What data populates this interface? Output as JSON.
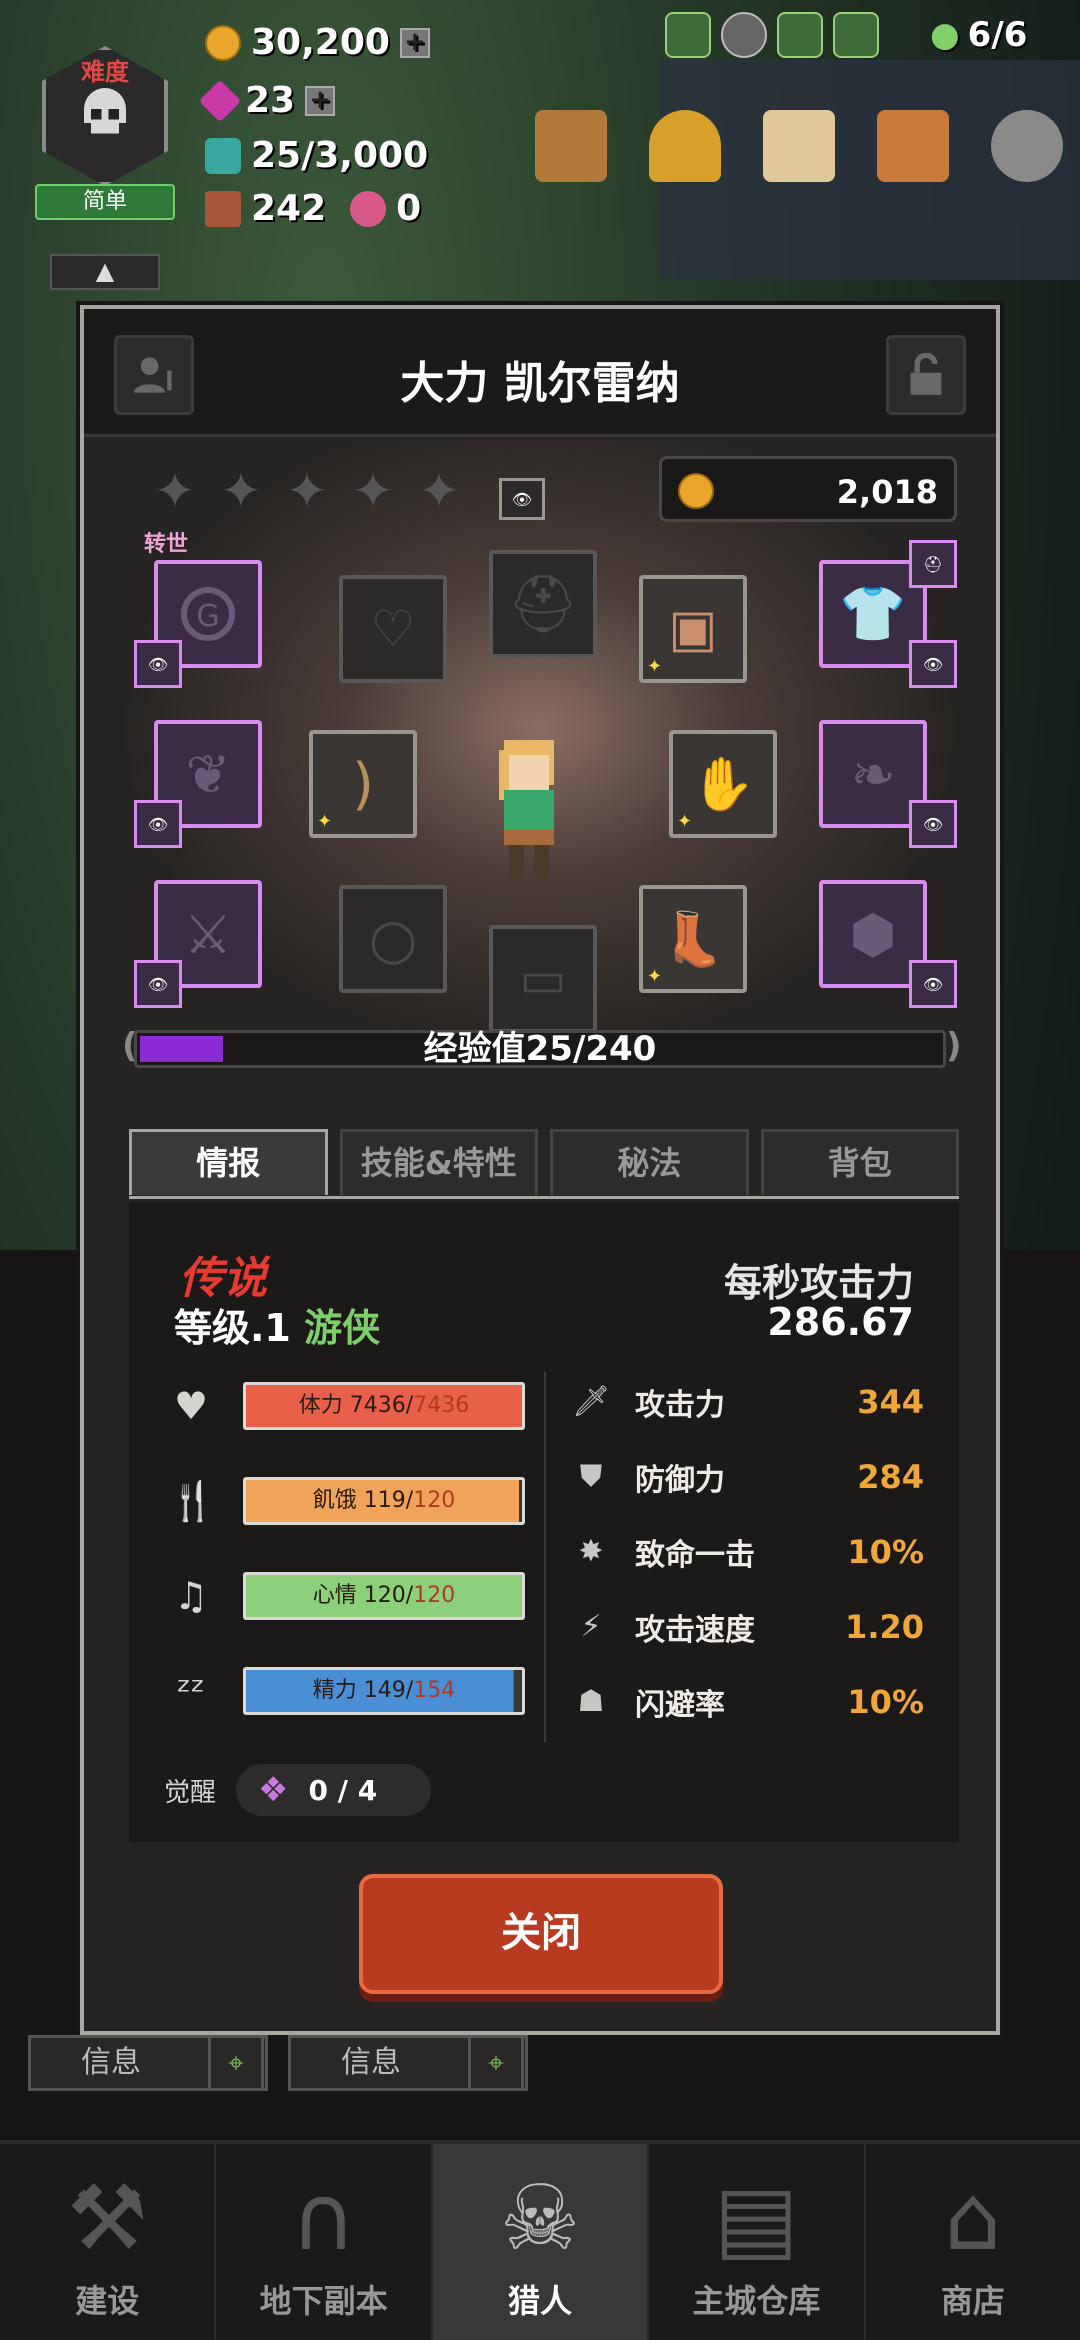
{
  "difficulty": {
    "label": "难度",
    "value": "简单"
  },
  "resources": {
    "gold": "30,200",
    "gems": "23",
    "mana": "25/3,000",
    "chests": "242",
    "crystals": "0"
  },
  "hunter_slots": "6/6",
  "modal": {
    "title": "大力 凯尔雷纳",
    "rebirth_label": "转世",
    "gold_amount": "2,018",
    "xp_text": "经验值25/240",
    "xp_progress": 0.104,
    "tabs": [
      {
        "label": "情报",
        "active": true
      },
      {
        "label": "技能&特性",
        "active": false
      },
      {
        "label": "秘法",
        "active": false
      },
      {
        "label": "背包",
        "active": false
      }
    ],
    "info": {
      "rarity": "传说",
      "level_prefix": "等级.1",
      "class_name": "游侠",
      "dps_label": "每秒攻击力",
      "dps_value": "286.67",
      "needs": [
        {
          "label": "体力",
          "current": "7436",
          "max": "7436",
          "color": "#e8604a",
          "fill": 1.0
        },
        {
          "label": "飢饿",
          "current": "119",
          "max": "120",
          "color": "#f0a45a",
          "fill": 0.99
        },
        {
          "label": "心情",
          "current": "120",
          "max": "120",
          "color": "#8cd07a",
          "fill": 1.0
        },
        {
          "label": "精力",
          "current": "149",
          "max": "154",
          "color": "#4a8fd6",
          "fill": 0.97
        }
      ],
      "stats": [
        {
          "name": "攻击力",
          "value": "344"
        },
        {
          "name": "防御力",
          "value": "284"
        },
        {
          "name": "致命一击",
          "value": "10%"
        },
        {
          "name": "攻击速度",
          "value": "1.20"
        },
        {
          "name": "闪避率",
          "value": "10%"
        }
      ],
      "awaken_label": "觉醒",
      "awaken_value": "0 / 4"
    },
    "close_label": "关闭"
  },
  "bg_cards": [
    {
      "label": "信息"
    },
    {
      "label": "信息"
    }
  ],
  "nav": [
    {
      "label": "建设",
      "icon": "hammer-icon",
      "active": false
    },
    {
      "label": "地下副本",
      "icon": "dungeon-gate-icon",
      "active": false
    },
    {
      "label": "猎人",
      "icon": "hunter-icon",
      "active": true
    },
    {
      "label": "主城仓库",
      "icon": "chest-icon",
      "active": false
    },
    {
      "label": "商店",
      "icon": "shop-icon",
      "active": false
    }
  ]
}
